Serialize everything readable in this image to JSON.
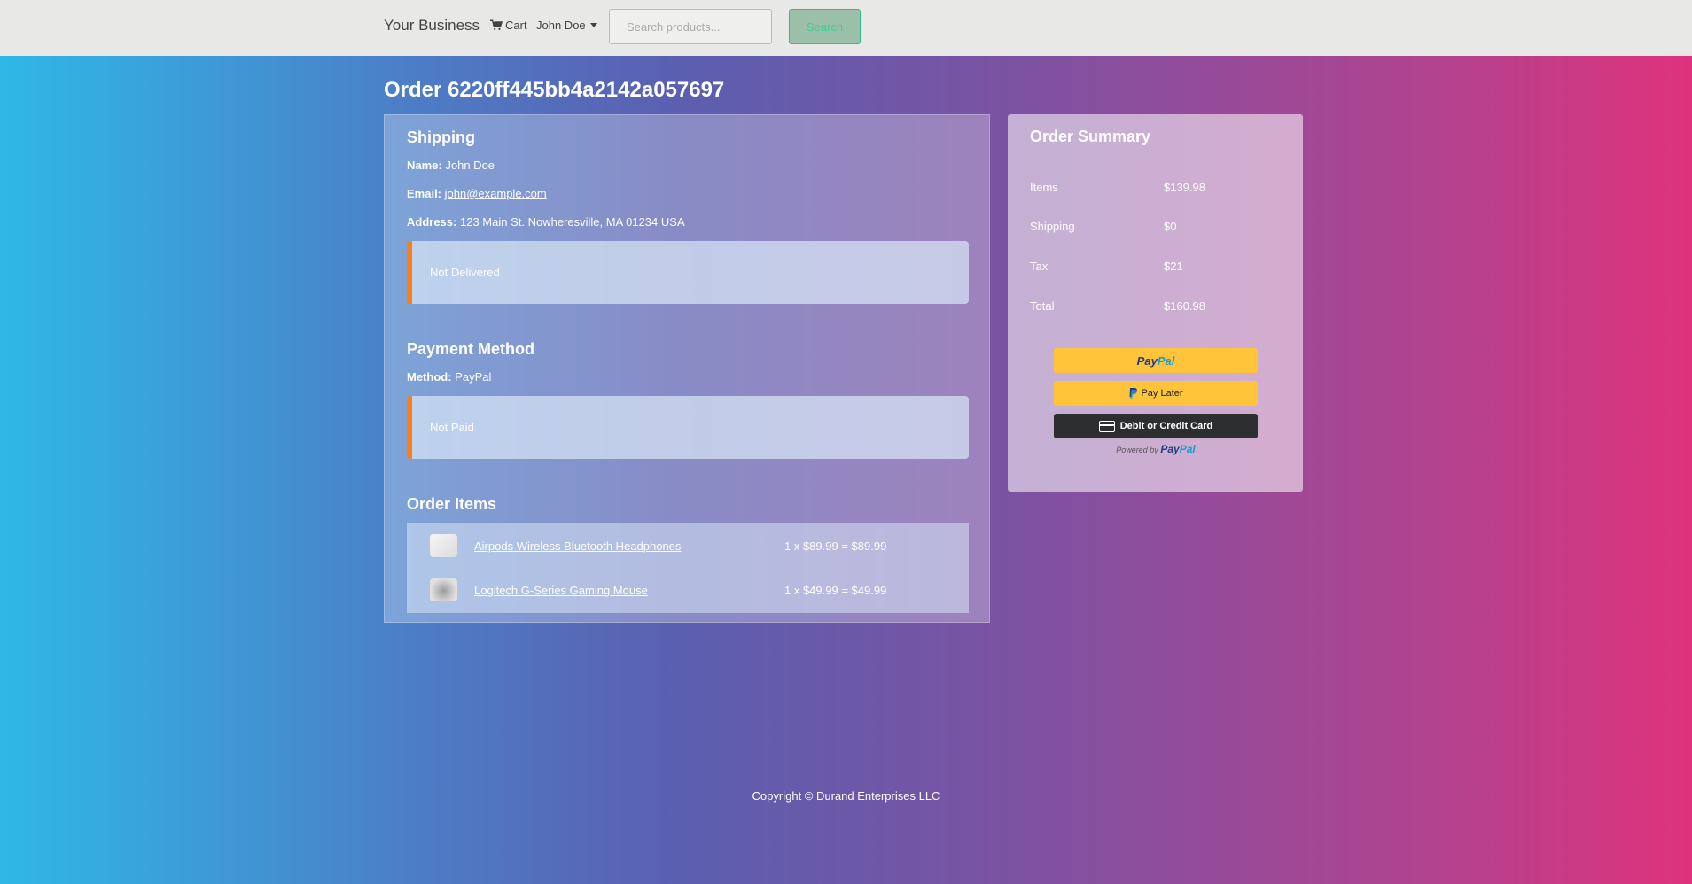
{
  "navbar": {
    "brand": "Your Business",
    "cart_label": "Cart",
    "user_name": "John Doe",
    "search_placeholder": "Search products...",
    "search_button": "Search"
  },
  "order": {
    "title": "Order 6220ff445bb4a2142a057697"
  },
  "shipping": {
    "heading": "Shipping",
    "name_label": "Name:",
    "name": "John Doe",
    "email_label": "Email:",
    "email": "john@example.com",
    "address_label": "Address:",
    "address": "123 Main St. Nowheresville, MA 01234 USA",
    "status": "Not Delivered"
  },
  "payment": {
    "heading": "Payment Method",
    "method_label": "Method:",
    "method": "PayPal",
    "status": "Not Paid"
  },
  "order_items": {
    "heading": "Order Items",
    "items": [
      {
        "name": "Airpods Wireless Bluetooth Headphones",
        "price_line": "1 x $89.99 = $89.99"
      },
      {
        "name": "Logitech G-Series Gaming Mouse",
        "price_line": "1 x $49.99 = $49.99"
      }
    ]
  },
  "summary": {
    "heading": "Order Summary",
    "rows": [
      {
        "label": "Items",
        "value": "$139.98"
      },
      {
        "label": "Shipping",
        "value": "$0"
      },
      {
        "label": "Tax",
        "value": "$21"
      },
      {
        "label": "Total",
        "value": "$160.98"
      }
    ],
    "paypal_pay": "Pay",
    "paypal_pal": "Pal",
    "pay_later": "Pay Later",
    "card_button": "Debit or Credit Card",
    "powered_by": "Powered by"
  },
  "footer": {
    "copyright": "Copyright © Durand Enterprises LLC"
  },
  "colors": {
    "status_accent": "#fd7e14",
    "paypal_yellow": "#ffc43a",
    "paypal_dark": "#2c2e2f",
    "search_green": "#2fc08a"
  }
}
